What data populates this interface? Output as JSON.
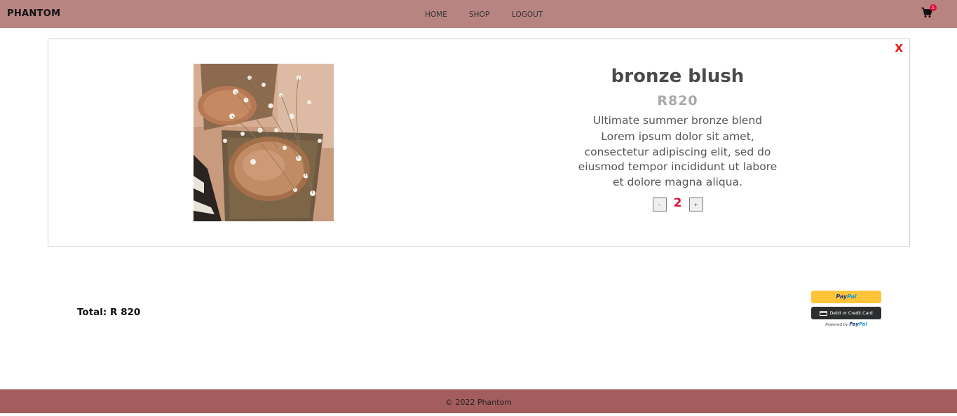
{
  "navbar": {
    "brand": "PHANTOM",
    "links": [
      "HOME",
      "SHOP",
      "LOGOUT"
    ],
    "cart_count": "1"
  },
  "product": {
    "close_label": "X",
    "title": "bronze blush",
    "price": "R820",
    "subtitle": "Ultimate summer bronze blend",
    "description": "Lorem ipsum dolor sit amet, consectetur adipiscing elit, sed do eiusmod tempor incididunt ut labore et dolore magna aliqua.",
    "decrement_label": "-",
    "quantity": "2",
    "increment_label": "+"
  },
  "cart": {
    "total": "Total: R 820"
  },
  "payment": {
    "paypal_pay": "Pay",
    "paypal_pal": "Pal",
    "card_label": "Debit or Credit Card",
    "powered_by": "Powered by",
    "powered_pay": "Pay",
    "powered_pal": "Pal"
  },
  "footer": {
    "text": "© 2022 Phantom"
  },
  "colors": {
    "navbar_bg": "#b88482",
    "footer_bg": "#a45d5d",
    "accent_red": "#e0133a",
    "close_red": "#ee1111",
    "paypal_yellow": "#ffc439"
  }
}
